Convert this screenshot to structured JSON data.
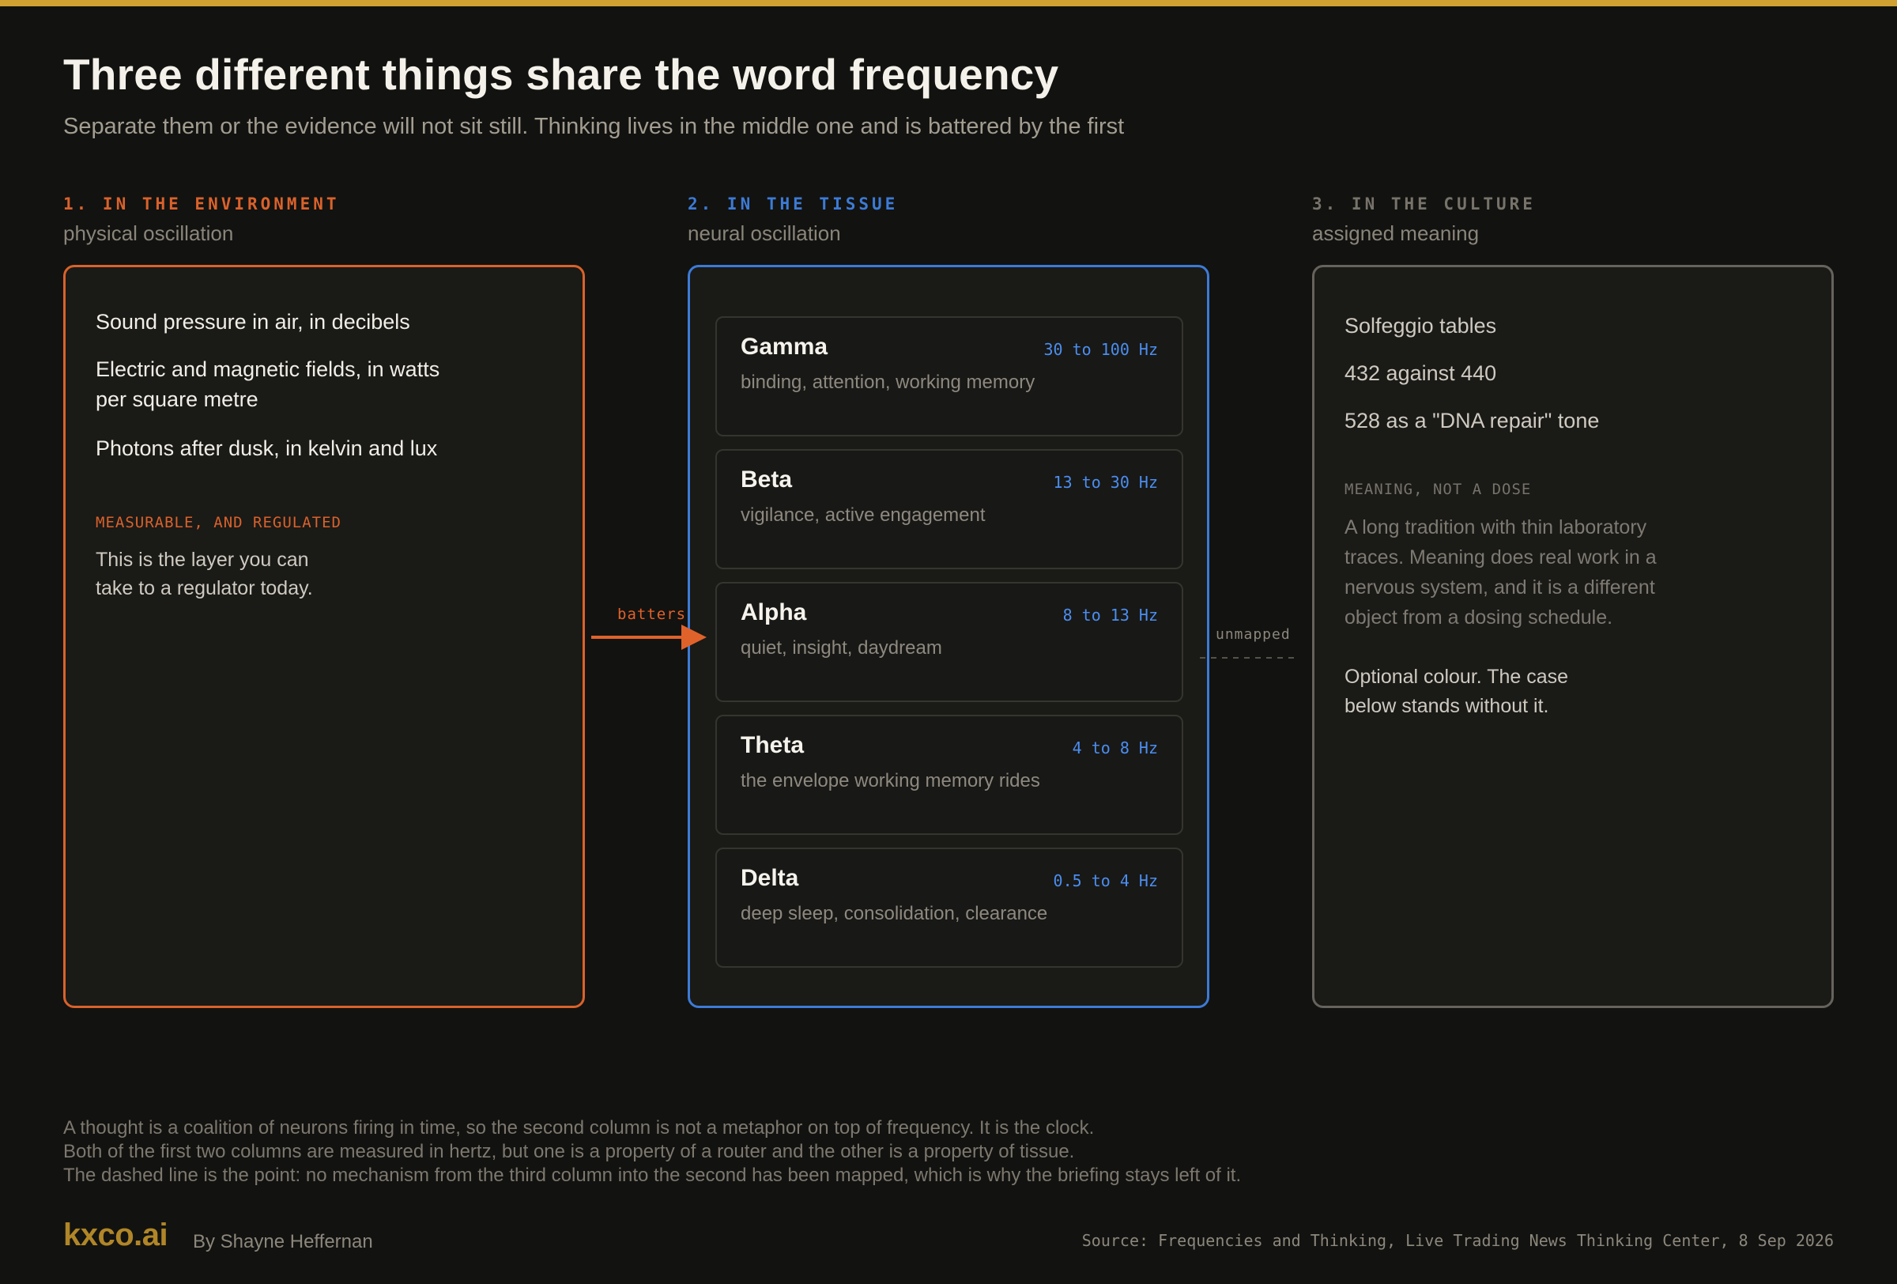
{
  "header": {
    "title": "Three different things share the word frequency",
    "subtitle": "Separate them or the evidence will not sit still. Thinking lives in the middle one and is battered by the first"
  },
  "columns": [
    {
      "label": "1. IN THE ENVIRONMENT",
      "sublabel": "physical oscillation",
      "accent": "#d9622b",
      "items": [
        "Sound pressure in air, in decibels",
        "Electric and magnetic fields, in watts per square metre",
        "Photons after dusk, in kelvin and lux"
      ],
      "note_label": "MEASURABLE, AND REGULATED",
      "note_text": "This is the layer you can take to a regulator today."
    },
    {
      "label": "2. IN THE TISSUE",
      "sublabel": "neural oscillation",
      "accent": "#3c7bd6",
      "bands": [
        {
          "name": "Gamma",
          "range": "30 to 100 Hz",
          "desc": "binding, attention, working memory"
        },
        {
          "name": "Beta",
          "range": "13 to 30 Hz",
          "desc": "vigilance, active engagement"
        },
        {
          "name": "Alpha",
          "range": "8 to 13 Hz",
          "desc": "quiet, insight, daydream"
        },
        {
          "name": "Theta",
          "range": "4 to 8 Hz",
          "desc": "the envelope working memory rides"
        },
        {
          "name": "Delta",
          "range": "0.5 to 4 Hz",
          "desc": "deep sleep, consolidation, clearance"
        }
      ]
    },
    {
      "label": "3. IN THE CULTURE",
      "sublabel": "assigned meaning",
      "accent": "#66635c",
      "items": [
        "Solfeggio tables",
        "432 against 440",
        "528 as a \"DNA repair\" tone"
      ],
      "note_label": "MEANING, NOT A DOSE",
      "note_text": "A long tradition with thin laboratory traces. Meaning does real work in a nervous system, and it is a different object from a dosing schedule.",
      "note_extra": "Optional colour. The case below stands without it."
    }
  ],
  "connectors": {
    "batters": "batters",
    "unmapped": "unmapped"
  },
  "footer": {
    "notes": [
      "A thought is a coalition of neurons firing in time, so the second column is not a metaphor on top of frequency. It is the clock.",
      "Both of the first two columns are measured in hertz, but one is a property of a router and the other is a property of tissue.",
      "The dashed line is the point: no mechanism from the third column into the second has been mapped, which is why the briefing stays left of it."
    ],
    "logo": "kxco.ai",
    "byline": "By Shayne Heffernan",
    "source": "Source: Frequencies and Thinking, Live Trading News Thinking Center, 8 Sep 2026"
  }
}
